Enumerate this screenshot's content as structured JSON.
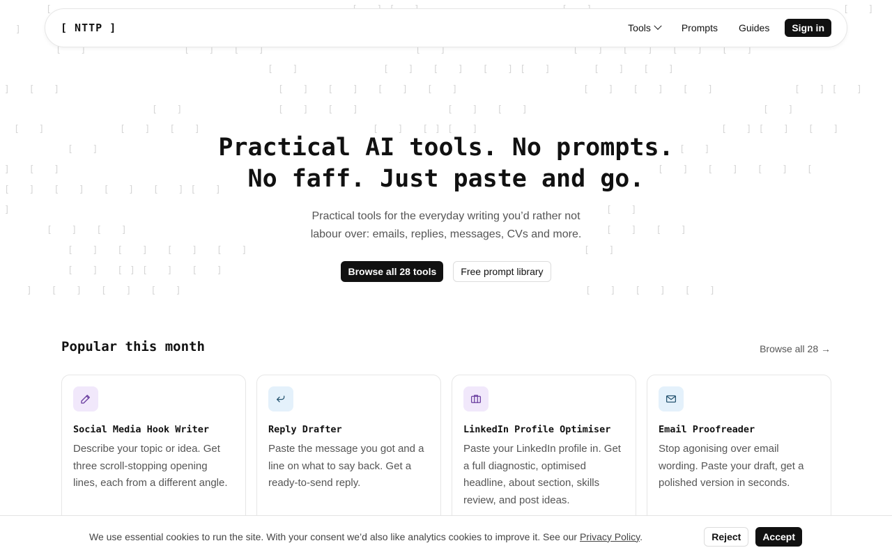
{
  "header": {
    "logo": "[ NTTP ]",
    "nav": [
      {
        "label": "Tools",
        "has_dropdown": true
      },
      {
        "label": "Prompts"
      },
      {
        "label": "Guides"
      }
    ],
    "signin_label": "Sign in"
  },
  "hero": {
    "title_line1": "Practical AI tools. No prompts.",
    "title_line2": "No faff. Just paste and go.",
    "subtitle_line1": "Practical tools for the everyday writing you’d rather not",
    "subtitle_line2": "labour over: emails, replies, messages, CVs and more.",
    "primary_button": "Browse all 28 tools",
    "secondary_button": "Free prompt library"
  },
  "popular": {
    "title": "Popular this month",
    "browse_link": "Browse all 28 →",
    "cards": [
      {
        "icon": "pencil-icon",
        "icon_bg": "#f1e8fb",
        "icon_color": "#6b3fa0",
        "title": "Social Media Hook Writer",
        "description": "Describe your topic or idea. Get three scroll-stopping opening lines, each from a different angle."
      },
      {
        "icon": "reply-arrow-icon",
        "icon_bg": "#e4f1fb",
        "icon_color": "#24536f",
        "title": "Reply Drafter",
        "description": "Paste the message you got and a line on what to say back. Get a ready-to-send reply."
      },
      {
        "icon": "briefcase-icon",
        "icon_bg": "#f1e8fb",
        "icon_color": "#6b3fa0",
        "title": "LinkedIn Profile Optimiser",
        "description": "Paste your LinkedIn profile in. Get a full diagnostic, optimised headline, about section, skills review, and post ideas."
      },
      {
        "icon": "envelope-icon",
        "icon_bg": "#e4f1fb",
        "icon_color": "#24536f",
        "title": "Email Proofreader",
        "description": "Stop agonising over email wording. Paste your draft, get a polished version in seconds."
      }
    ]
  },
  "cookie": {
    "text": "We use essential cookies to run the site. With your consent we’d also like analytics cookies to improve it. See our",
    "link_label": "Privacy Policy",
    "after_link": ".",
    "reject_label": "Reject",
    "accept_label": "Accept"
  }
}
